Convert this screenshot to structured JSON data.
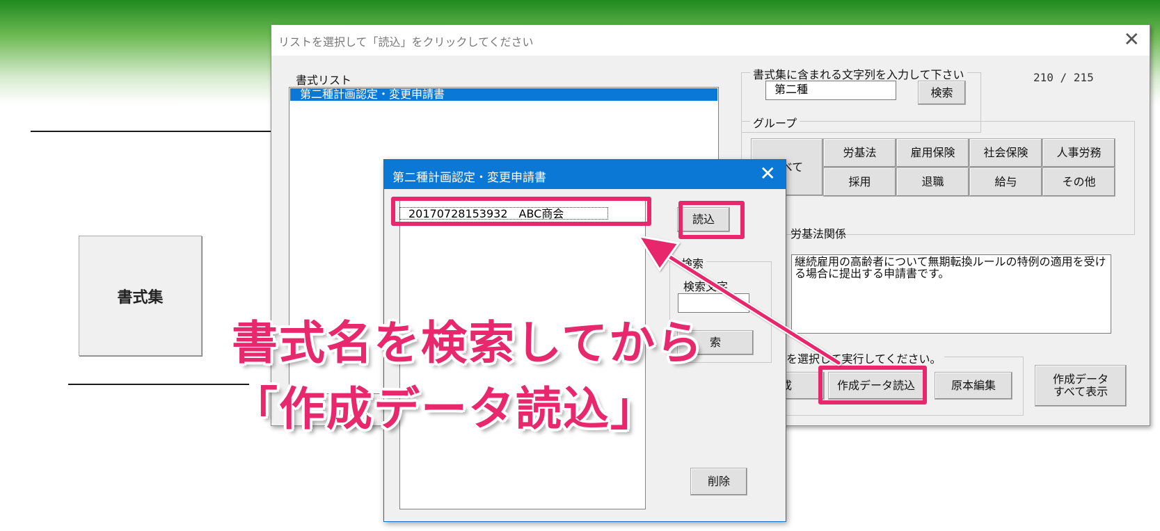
{
  "main_dialog": {
    "title": "リストを選択して「読込」をクリックしてください",
    "list_label": "書式リスト",
    "selected_item": "第二種計画認定・変更申請書",
    "search_group_caption": "書式集に含まれる文字列を入力して下さい",
    "search_value": "第二種",
    "search_button": "検索",
    "counter": "210 / 215",
    "group_caption": "グループ",
    "group_buttons": {
      "all": "すべて",
      "labor_standards": "労基法",
      "employment_insurance": "雇用保険",
      "social_insurance": "社会保険",
      "hr": "人事労務",
      "hiring": "採用",
      "retirement": "退職",
      "salary": "給与",
      "other": "その他"
    },
    "category_label": "労基法関係",
    "description": "継続雇用の高齢者について無期転換ルールの特例の適用を受ける場合に提出する申請書です。",
    "action_caption": "リストを選択して実行してください。",
    "buttons": {
      "create_partial": "成",
      "load_data": "作成データ読込",
      "edit_original": "原本編集",
      "show_all": "作成データ\nすべて表示"
    }
  },
  "sub_dialog": {
    "title": "第二種計画認定・変更申請書",
    "list_item": "20170728153932　ABC商会",
    "load_button": "読込",
    "search_caption": "検索",
    "search_label": "検索文字",
    "search_button_partial": "索",
    "delete_button": "削除"
  },
  "background": {
    "sheet_button": "書式集"
  },
  "annotation": {
    "line1": "書式名を検索してから",
    "line2": "「作成データ読込」",
    "color": "#e8286c"
  }
}
